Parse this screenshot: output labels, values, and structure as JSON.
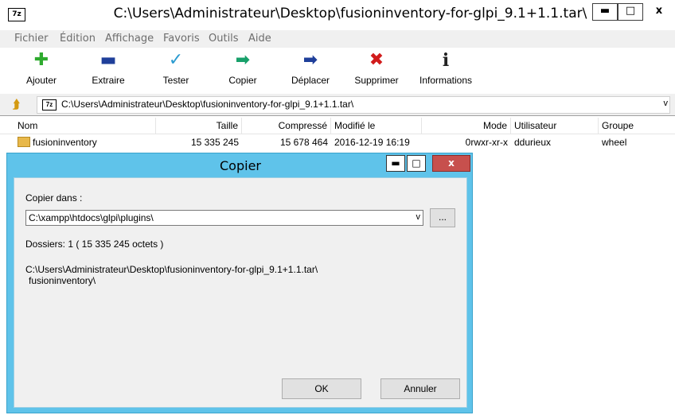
{
  "window": {
    "icon_text": "7z",
    "title": "C:\\Users\\Administrateur\\Desktop\\fusioninventory-for-glpi_9.1+1.1.tar\\",
    "minimize": "▬",
    "maximize": "□",
    "close": "x"
  },
  "menu": [
    "Fichier",
    "Édition",
    "Affichage",
    "Favoris",
    "Outils",
    "Aide"
  ],
  "toolbar": [
    {
      "label": "Ajouter",
      "icon": "plus-icon",
      "glyph": "✚",
      "color": "#2eaa2e"
    },
    {
      "label": "Extraire",
      "icon": "minus-icon",
      "glyph": "▬",
      "color": "#1f3f9a"
    },
    {
      "label": "Tester",
      "icon": "check-icon",
      "glyph": "✓",
      "color": "#2b9bd0"
    },
    {
      "label": "Copier",
      "icon": "copy-arrow-icon",
      "glyph": "➡",
      "color": "#18a06a"
    },
    {
      "label": "Déplacer",
      "icon": "move-arrow-icon",
      "glyph": "➡",
      "color": "#1f3f9a"
    },
    {
      "label": "Supprimer",
      "icon": "delete-icon",
      "glyph": "✖",
      "color": "#d11b1b"
    },
    {
      "label": "Informations",
      "icon": "info-icon",
      "glyph": "i",
      "color": "#222222"
    }
  ],
  "address": {
    "icon_text": "7z",
    "path": "C:\\Users\\Administrateur\\Desktop\\fusioninventory-for-glpi_9.1+1.1.tar\\",
    "chevron": "v"
  },
  "columns": {
    "name": "Nom",
    "size": "Taille",
    "packed": "Compressé",
    "modified": "Modifié le",
    "mode": "Mode",
    "user": "Utilisateur",
    "group": "Groupe"
  },
  "files": [
    {
      "name": "fusioninventory",
      "size": "15 335 245",
      "packed": "15 678 464",
      "modified": "2016-12-19 16:19",
      "mode": "0rwxr-xr-x",
      "user": "ddurieux",
      "group": "wheel"
    }
  ],
  "dialog": {
    "title": "Copier",
    "minimize": "▬",
    "maximize": "□",
    "close": "x",
    "copy_to_label": "Copier dans :",
    "destination": "C:\\xampp\\htdocs\\glpi\\plugins\\",
    "combo_chevron": "v",
    "browse": "...",
    "summary": "Dossiers: 1    ( 15 335 245 octets )",
    "source_line1": "C:\\Users\\Administrateur\\Desktop\\fusioninventory-for-glpi_9.1+1.1.tar\\",
    "source_line2": "fusioninventory\\",
    "ok": "OK",
    "cancel": "Annuler",
    "accent_color": "#5fc3ea"
  }
}
